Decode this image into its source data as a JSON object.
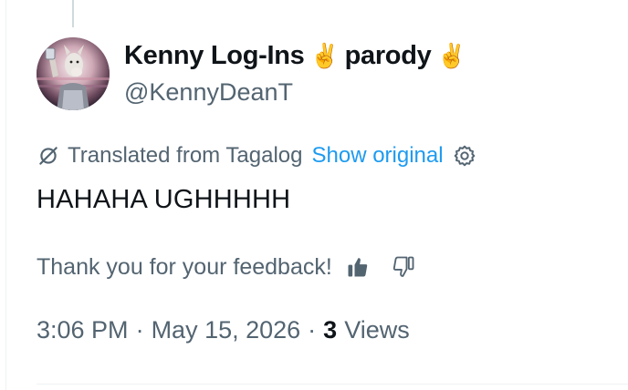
{
  "author": {
    "display_name": "Kenny Log-Ins",
    "name_suffix": "parody",
    "emoji_left": "✌️",
    "emoji_right": "✌️",
    "handle": "@KennyDeanT"
  },
  "translation": {
    "text": "Translated from Tagalog",
    "show_original_label": "Show original",
    "icon": "translate-slash-icon",
    "settings_icon": "gear-icon"
  },
  "tweet": {
    "text": "HAHAHA UGHHHHH"
  },
  "feedback": {
    "text": "Thank you for your feedback!",
    "up_icon": "thumbs-up-icon",
    "down_icon": "thumbs-down-icon"
  },
  "meta": {
    "time": "3:06 PM",
    "separator": "·",
    "date": "May 15, 2026",
    "views_count": "3",
    "views_label": "Views"
  },
  "colors": {
    "link": "#1d9bf0",
    "secondary": "#536471",
    "primary": "#0f1419"
  }
}
